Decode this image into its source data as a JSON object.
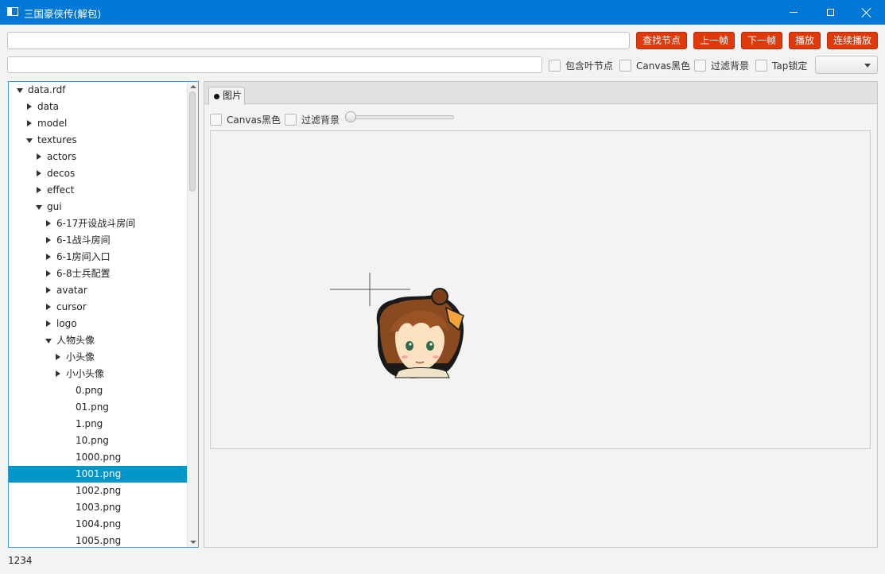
{
  "window": {
    "title": "三国豪侠传(解包)"
  },
  "toolbar": {
    "search_value": "",
    "path_value": "",
    "find_node": "查找节点",
    "prev_frame": "上一帧",
    "next_frame": "下一帧",
    "play": "播放",
    "continuous_play": "连续播放",
    "include_leaf": "包含叶节点",
    "canvas_black": "Canvas黑色",
    "filter_bg": "过滤背景",
    "tap_lock": "Tap锁定",
    "combo_value": ""
  },
  "tree": {
    "rows": [
      {
        "label": "data.rdf",
        "expanded": true
      },
      {
        "label": "data",
        "expanded": false
      },
      {
        "label": "model",
        "expanded": false
      },
      {
        "label": "textures",
        "expanded": true
      },
      {
        "label": "actors",
        "expanded": false
      },
      {
        "label": "decos",
        "expanded": false
      },
      {
        "label": "effect",
        "expanded": false
      },
      {
        "label": "gui",
        "expanded": true
      },
      {
        "label": "6-17开设战斗房间",
        "expanded": false
      },
      {
        "label": "6-1战斗房间",
        "expanded": false
      },
      {
        "label": "6-1房间入口",
        "expanded": false
      },
      {
        "label": "6-8士兵配置",
        "expanded": false
      },
      {
        "label": "avatar",
        "expanded": false
      },
      {
        "label": "cursor",
        "expanded": false
      },
      {
        "label": "logo",
        "expanded": false
      },
      {
        "label": "人物头像",
        "expanded": true
      },
      {
        "label": "小头像",
        "expanded": false
      },
      {
        "label": "小小头像",
        "expanded": false
      },
      {
        "label": "0.png"
      },
      {
        "label": "01.png"
      },
      {
        "label": "1.png"
      },
      {
        "label": "10.png"
      },
      {
        "label": "1000.png"
      },
      {
        "label": "1001.png",
        "selected": true
      },
      {
        "label": "1002.png"
      },
      {
        "label": "1003.png"
      },
      {
        "label": "1004.png"
      },
      {
        "label": "1005.png"
      }
    ]
  },
  "viewer": {
    "tab_label": "图片",
    "canvas_black": "Canvas黑色",
    "filter_bg": "过滤背景",
    "slider_value": 0
  },
  "status": {
    "text": "1234"
  }
}
